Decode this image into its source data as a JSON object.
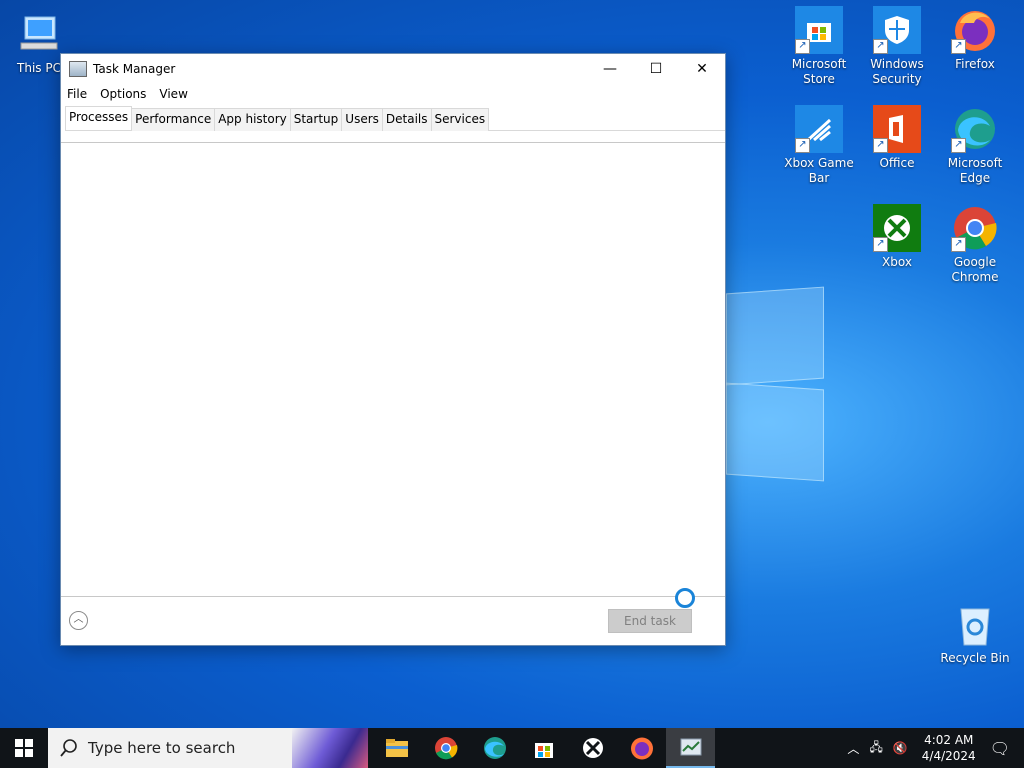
{
  "desktop": {
    "icons": [
      {
        "label": "This PC"
      },
      {
        "label": "Microsoft Store"
      },
      {
        "label": "Windows Security"
      },
      {
        "label": "Firefox"
      },
      {
        "label": "Xbox Game Bar"
      },
      {
        "label": "Office"
      },
      {
        "label": "Microsoft Edge"
      },
      {
        "label": "Xbox"
      },
      {
        "label": "Google Chrome"
      },
      {
        "label": "Recycle Bin"
      }
    ]
  },
  "task_manager": {
    "title": "Task Manager",
    "menu": [
      "File",
      "Options",
      "View"
    ],
    "tabs": [
      "Processes",
      "Performance",
      "App history",
      "Startup",
      "Users",
      "Details",
      "Services"
    ],
    "active_tab": "Processes",
    "end_task_label": "End task",
    "controls": {
      "minimize": "—",
      "maximize": "☐",
      "close": "✕"
    }
  },
  "taskbar": {
    "search_placeholder": "Type here to search",
    "apps": [
      "file-explorer-icon",
      "chrome-icon",
      "edge-icon",
      "store-icon",
      "xbox-icon",
      "firefox-icon",
      "task-manager-icon"
    ],
    "time": "4:02 AM",
    "date": "4/4/2024"
  },
  "colors": {
    "desktop_blue": "#0b5fd0",
    "taskbar": "#101418",
    "accent": "#1a84d8"
  }
}
